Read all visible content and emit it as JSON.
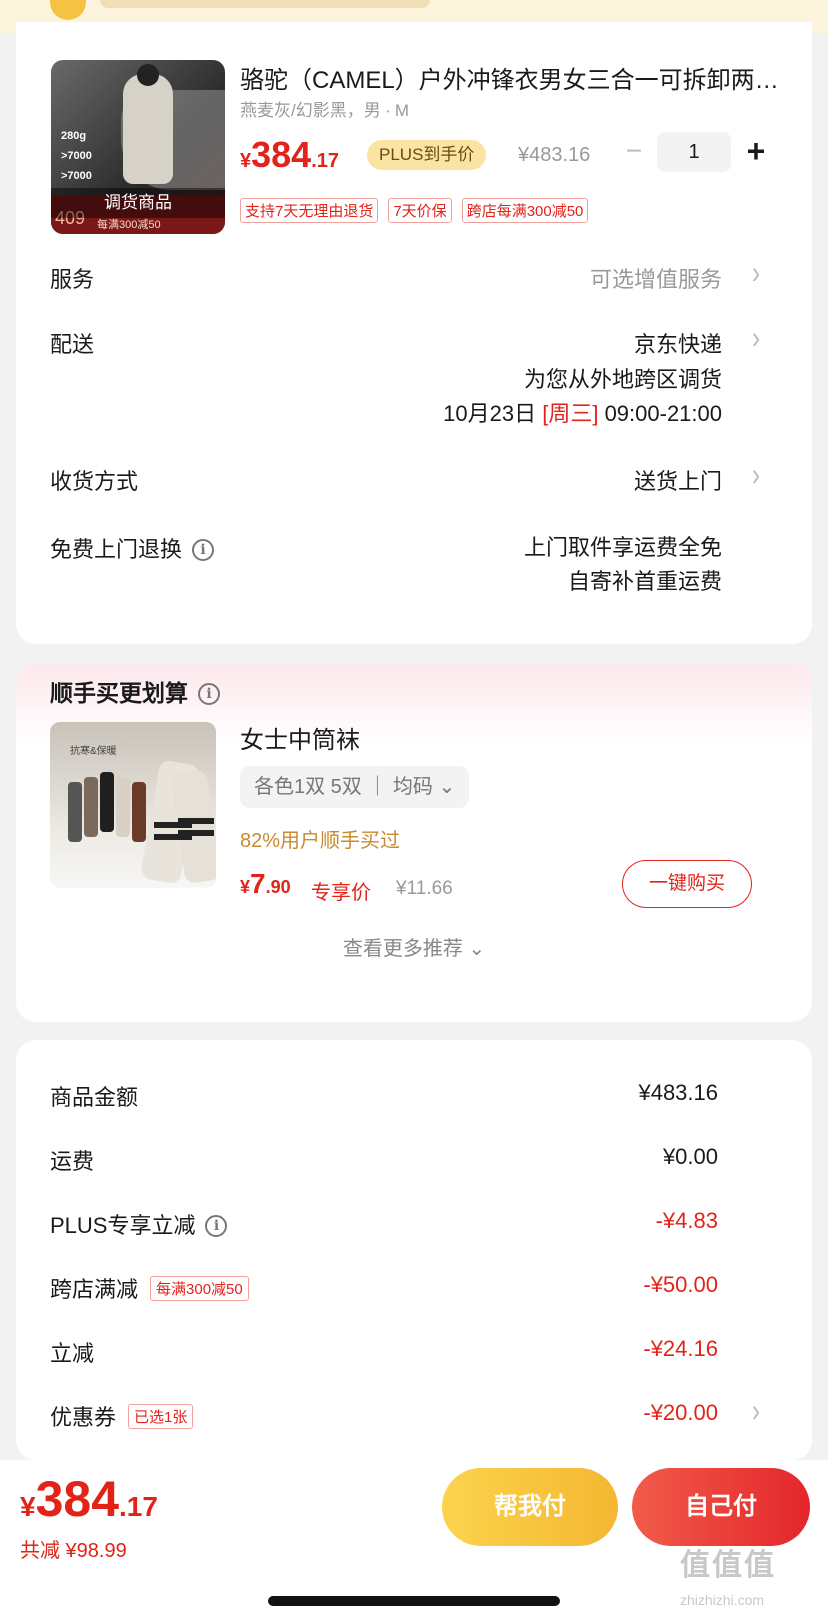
{
  "product": {
    "title": "骆驼（CAMEL）户外冲锋衣男女三合一可拆卸两件套外套",
    "variant": "燕麦灰/幻影黑，男 ∙ M",
    "image_badge": "调货商品",
    "image_specs": [
      "280g",
      ">7000",
      ">7000"
    ],
    "image_price": "409",
    "image_promo": "每满300减50",
    "price_symbol": "¥",
    "price_int": "384",
    "price_dec": ".17",
    "plus_label": "PLUS到手价",
    "original_price": "¥483.16",
    "minus": "−",
    "quantity": "1",
    "plus": "+",
    "tags": [
      "支持7天无理由退货",
      "7天价保",
      "跨店每满300减50"
    ]
  },
  "rows": {
    "service_label": "服务",
    "service_value": "可选增值服务",
    "delivery_label": "配送",
    "delivery_value": "京东快递",
    "delivery_note": "为您从外地跨区调货",
    "delivery_date": "10月23日",
    "delivery_weekday": "[周三]",
    "delivery_time": "09:00-21:00",
    "receive_label": "收货方式",
    "receive_value": "送货上门",
    "return_label": "免费上门退换",
    "return_value1": "上门取件享运费全免",
    "return_value2": "自寄补首重运费"
  },
  "recommend": {
    "title": "顺手买更划算",
    "image_text": "抗寒&保暖",
    "name": "女士中筒袜",
    "option": "各色1双 5双 ｜ 均码 ⌄",
    "percent": "82%用户顺手买过",
    "price_symbol": "¥",
    "price_int": "7",
    "price_dec": ".90",
    "price_label": "专享价",
    "original_price": "¥11.66",
    "buy_button": "一键购买",
    "more": "查看更多推荐 ⌄"
  },
  "summary": {
    "items": [
      {
        "label": "商品金额",
        "value": "¥483.16"
      },
      {
        "label": "运费",
        "value": "¥0.00"
      },
      {
        "label": "PLUS专享立减",
        "value": "-¥4.83"
      },
      {
        "label": "跨店满减",
        "value": "-¥50.00",
        "tag": "每满300减50"
      },
      {
        "label": "立减",
        "value": "-¥24.16"
      },
      {
        "label": "优惠券",
        "value": "-¥20.00",
        "tag": "已选1张"
      }
    ]
  },
  "footer": {
    "price_symbol": "¥",
    "price_int": "384",
    "price_dec": ".17",
    "discount": "共减 ¥98.99",
    "help_pay": "帮我付",
    "self_pay": "自己付",
    "watermark": "值值值",
    "watermark_url": "zhizhizhi.com"
  },
  "colors": {
    "accent": "#e2231a",
    "gold": "#f4b731",
    "plus_bg": "#fbe3a4"
  },
  "icons": [
    "info-icon",
    "chevron-right-icon",
    "chevron-down-icon"
  ]
}
